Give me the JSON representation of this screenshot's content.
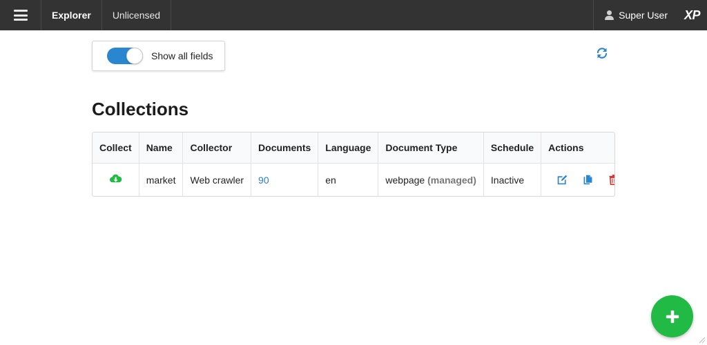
{
  "topbar": {
    "menu_icon": "hamburger-icon",
    "app_name": "Explorer",
    "license": "Unlicensed",
    "user_name": "Super User",
    "user_icon": "user-icon",
    "logo": "XP"
  },
  "toolbar": {
    "toggle_label": "Show all fields",
    "toggle_on": true,
    "refresh_icon": "refresh-icon"
  },
  "page": {
    "heading": "Collections"
  },
  "table": {
    "columns": [
      "Collect",
      "Name",
      "Collector",
      "Documents",
      "Language",
      "Document Type",
      "Schedule",
      "Actions"
    ],
    "rows": [
      {
        "collect_icon": "cloud-download-icon",
        "name": "market",
        "collector": "Web crawler",
        "documents": "90",
        "language": "en",
        "document_type": "webpage",
        "document_type_note": "(managed)",
        "schedule": "Inactive",
        "actions": [
          "edit-icon",
          "copy-icon",
          "trash-icon"
        ]
      }
    ]
  },
  "fab": {
    "icon": "plus-icon"
  },
  "colors": {
    "topbar": "#333333",
    "accent_blue": "#2a86d0",
    "link_blue": "#2a7cc0",
    "green": "#21ba45",
    "danger_red": "#db2828"
  }
}
